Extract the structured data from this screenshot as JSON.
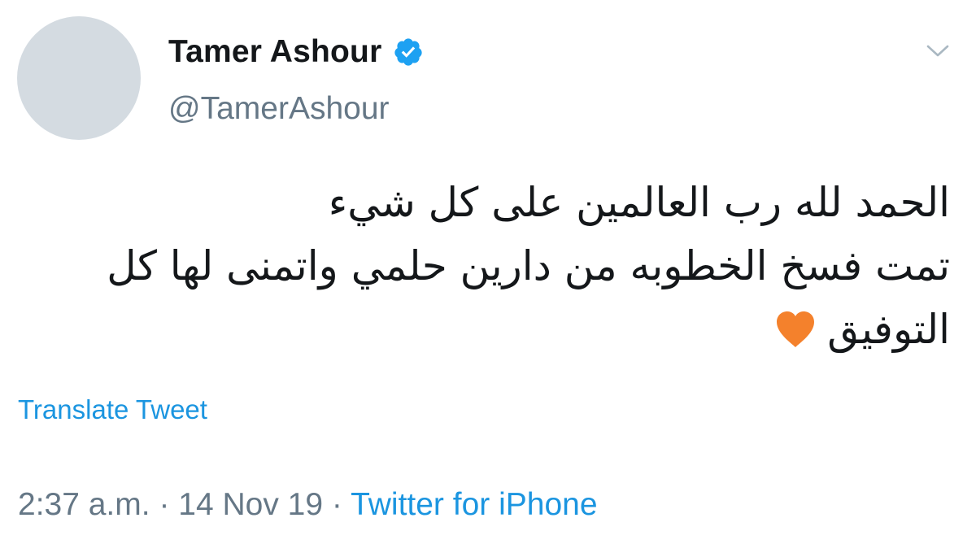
{
  "author": {
    "display_name": "Tamer Ashour",
    "handle": "@TamerAshour",
    "verified": true
  },
  "tweet": {
    "lines": [
      "الحمد لله رب العالمين على كل شيء",
      "تمت فسخ الخطوبه من دارين حلمي واتمنى لها كل",
      "التوفيق"
    ],
    "emoji": "orange-heart"
  },
  "translate_label": "Translate Tweet",
  "meta": {
    "time": "2:37 a.m.",
    "separator": "·",
    "date": "14 Nov 19",
    "source": "Twitter for iPhone"
  },
  "colors": {
    "link": "#1b95e0",
    "secondary_text": "#657786",
    "verified_badge": "#1da1f2",
    "heart": "#f4812c",
    "avatar_placeholder": "#d4dbe1"
  }
}
